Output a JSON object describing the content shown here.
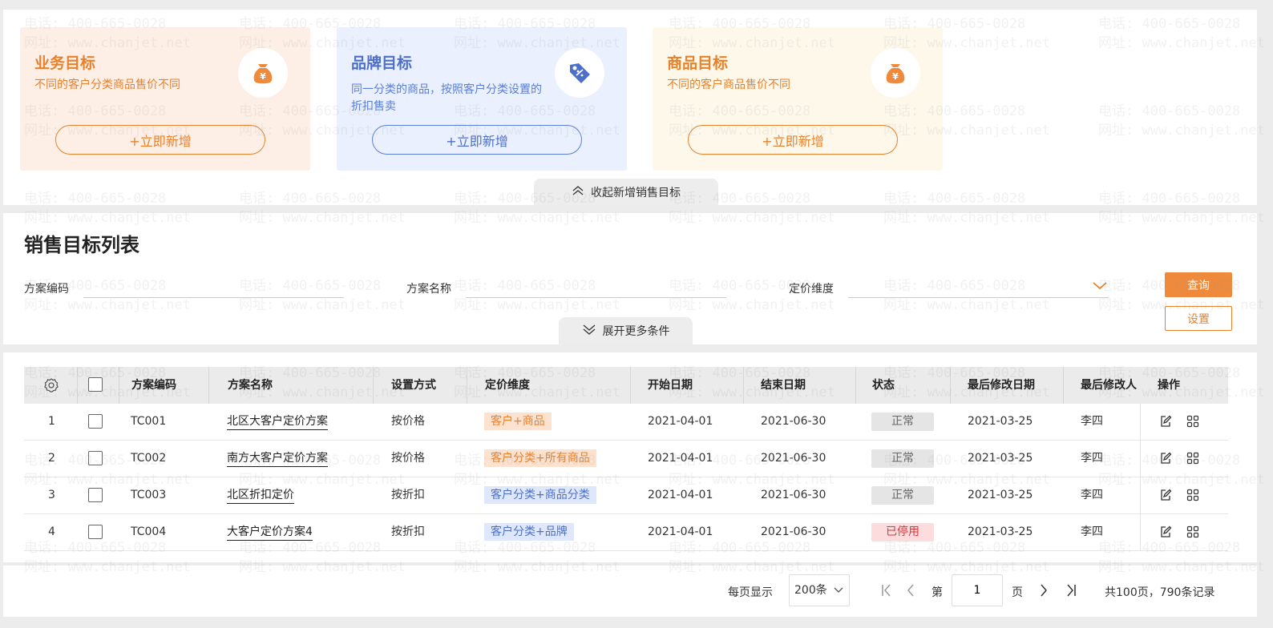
{
  "colors": {
    "accent": "#ef8a3c",
    "brand_blue": "#4d6fc9",
    "stopped": "#d9363e"
  },
  "watermark": {
    "phone": "电话: 400-665-0028",
    "site": "网址: www.chanjet.net"
  },
  "cards": [
    {
      "title": "业务目标",
      "desc": "不同的客户分类商品售价不同",
      "icon": "money-bag-icon",
      "button": "+立即新增"
    },
    {
      "title": "品牌目标",
      "desc": "同一分类的商品，按照客户分类设置的折扣售卖",
      "icon": "discount-tag-icon",
      "button": "+立即新增"
    },
    {
      "title": "商品目标",
      "desc": "不同的客户商品售价不同",
      "icon": "money-bag-icon",
      "button": "+立即新增"
    }
  ],
  "collapse_label": "收起新增销售目标",
  "list_title": "销售目标列表",
  "filters": {
    "code_label": "方案编码",
    "name_label": "方案名称",
    "dimension_label": "定价维度",
    "code_value": "",
    "name_value": "",
    "dimension_value": "",
    "query": "查询",
    "setting": "设置",
    "expand": "展开更多条件"
  },
  "table": {
    "headers": [
      "方案编码",
      "方案名称",
      "设置方式",
      "定价维度",
      "开始日期",
      "结束日期",
      "状态",
      "最后修改日期",
      "最后修改人",
      "操作"
    ],
    "rows": [
      {
        "no": "1",
        "code": "TC001",
        "name": "北区大客户定价方案",
        "method": "按价格",
        "dimension": "客户+商品",
        "dim_color": "orange",
        "start": "2021-04-01",
        "end": "2021-06-30",
        "status": "正常",
        "status_type": "normal",
        "modified": "2021-03-25",
        "modifier": "李四"
      },
      {
        "no": "2",
        "code": "TC002",
        "name": "南方大客户定价方案",
        "method": "按价格",
        "dimension": "客户分类+所有商品",
        "dim_color": "orange",
        "start": "2021-04-01",
        "end": "2021-06-30",
        "status": "正常",
        "status_type": "normal",
        "modified": "2021-03-25",
        "modifier": "李四"
      },
      {
        "no": "3",
        "code": "TC003",
        "name": "北区折扣定价",
        "method": "按折扣",
        "dimension": "客户分类+商品分类",
        "dim_color": "blue",
        "start": "2021-04-01",
        "end": "2021-06-30",
        "status": "正常",
        "status_type": "normal",
        "modified": "2021-03-25",
        "modifier": "李四"
      },
      {
        "no": "4",
        "code": "TC004",
        "name": "大客户定价方案4",
        "method": "按折扣",
        "dimension": "客户分类+品牌",
        "dim_color": "blue",
        "start": "2021-04-01",
        "end": "2021-06-30",
        "status": "已停用",
        "status_type": "stopped",
        "modified": "2021-03-25",
        "modifier": "李四"
      }
    ]
  },
  "pagination": {
    "per_page_label": "每页显示",
    "per_page_value": "200条",
    "page_prefix": "第",
    "current_page": "1",
    "page_suffix": "页",
    "summary": "共100页，790条记录"
  }
}
